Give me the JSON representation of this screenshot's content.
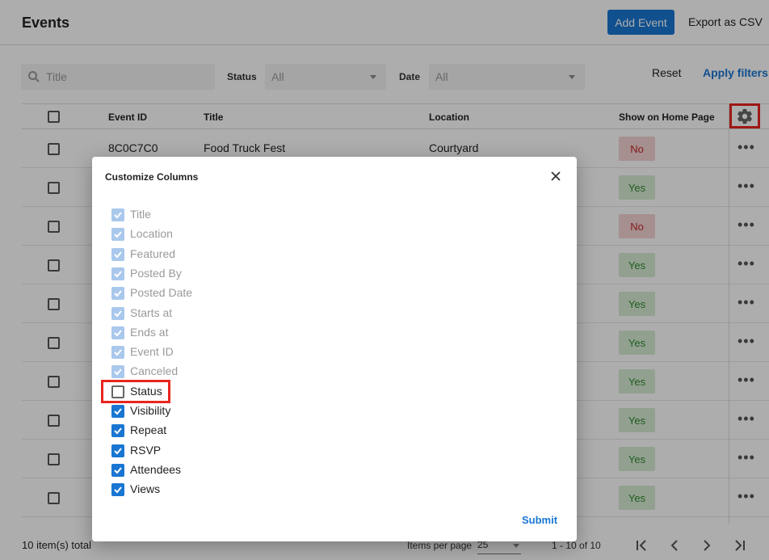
{
  "header": {
    "title": "Events",
    "add_event_label": "Add Event",
    "export_label": "Export as CSV"
  },
  "filters": {
    "search_placeholder": "Title",
    "status_label": "Status",
    "status_value": "All",
    "date_label": "Date",
    "date_value": "All",
    "reset_label": "Reset",
    "apply_label": "Apply filters"
  },
  "table": {
    "columns": [
      "Event ID",
      "Title",
      "Location",
      "Show on Home Page"
    ],
    "rows": [
      {
        "id": "8C0C7C0",
        "title": "Food Truck Fest",
        "location": "Courtyard",
        "home": "No"
      },
      {
        "id": "",
        "title": "",
        "location": "",
        "home": "Yes"
      },
      {
        "id": "",
        "title": "",
        "location": "",
        "home": "No"
      },
      {
        "id": "",
        "title": "",
        "location": "",
        "home": "Yes"
      },
      {
        "id": "",
        "title": "",
        "location": "",
        "home": "Yes"
      },
      {
        "id": "",
        "title": "",
        "location": "",
        "home": "Yes"
      },
      {
        "id": "",
        "title": "",
        "location": "",
        "home": "Yes"
      },
      {
        "id": "",
        "title": "",
        "location": "",
        "home": "Yes"
      },
      {
        "id": "",
        "title": "",
        "location": "",
        "home": "Yes"
      },
      {
        "id": "",
        "title": "",
        "location": "",
        "home": "Yes"
      }
    ]
  },
  "footer": {
    "total": "10 item(s) total",
    "items_per_page_label": "Items per page",
    "items_per_page_value": "25",
    "range": "1 - 10 of 10"
  },
  "modal": {
    "title": "Customize Columns",
    "submit_label": "Submit",
    "options": [
      {
        "label": "Title",
        "state": "disabled"
      },
      {
        "label": "Location",
        "state": "disabled"
      },
      {
        "label": "Featured",
        "state": "disabled"
      },
      {
        "label": "Posted By",
        "state": "disabled"
      },
      {
        "label": "Posted Date",
        "state": "disabled"
      },
      {
        "label": "Starts at",
        "state": "disabled"
      },
      {
        "label": "Ends at",
        "state": "disabled"
      },
      {
        "label": "Event ID",
        "state": "disabled"
      },
      {
        "label": "Canceled",
        "state": "disabled"
      },
      {
        "label": "Status",
        "state": "unchecked"
      },
      {
        "label": "Visibility",
        "state": "checked"
      },
      {
        "label": "Repeat",
        "state": "checked"
      },
      {
        "label": "RSVP",
        "state": "checked"
      },
      {
        "label": "Attendees",
        "state": "checked"
      },
      {
        "label": "Views",
        "state": "checked"
      }
    ]
  },
  "colors": {
    "accent": "#1976d2",
    "highlight": "#e8261e",
    "yes_bg": "#d7ecd4",
    "no_bg": "#f5d3d3"
  }
}
